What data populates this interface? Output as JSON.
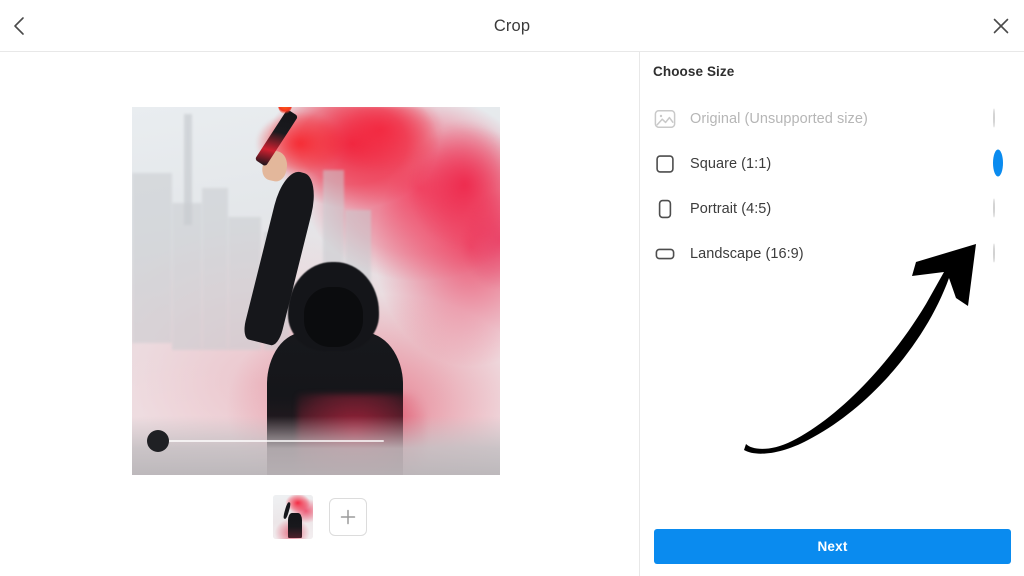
{
  "header": {
    "title": "Crop",
    "back_icon": "chevron-left-icon",
    "close_icon": "close-icon"
  },
  "preview": {
    "photo_alt": "Person in black hoodie holding a red smoke flare in front of a city skyline",
    "slider_handle": "crop-position-handle",
    "thumbnail_alt": "Selected photo thumbnail",
    "add_photo_icon": "plus-icon"
  },
  "options_panel": {
    "heading": "Choose Size",
    "options": [
      {
        "label": "Original (Unsupported size)",
        "icon": "image-placeholder-icon",
        "selected": false,
        "disabled": true
      },
      {
        "label": "Square (1:1)",
        "icon": "square-icon",
        "selected": true,
        "disabled": false
      },
      {
        "label": "Portrait (4:5)",
        "icon": "portrait-rectangle-icon",
        "selected": false,
        "disabled": false
      },
      {
        "label": "Landscape (16:9)",
        "icon": "landscape-rectangle-icon",
        "selected": false,
        "disabled": false
      }
    ]
  },
  "annotation": {
    "shape": "curved-arrow-up-right",
    "color": "#000000",
    "points_at": "Landscape (16:9)"
  },
  "footer": {
    "next_label": "Next"
  },
  "colors": {
    "accent": "#0a8bef",
    "background": "#ffffff",
    "border": "#e8e8e8",
    "text": "#3c3c3c",
    "text_disabled": "#b6b6b6"
  }
}
